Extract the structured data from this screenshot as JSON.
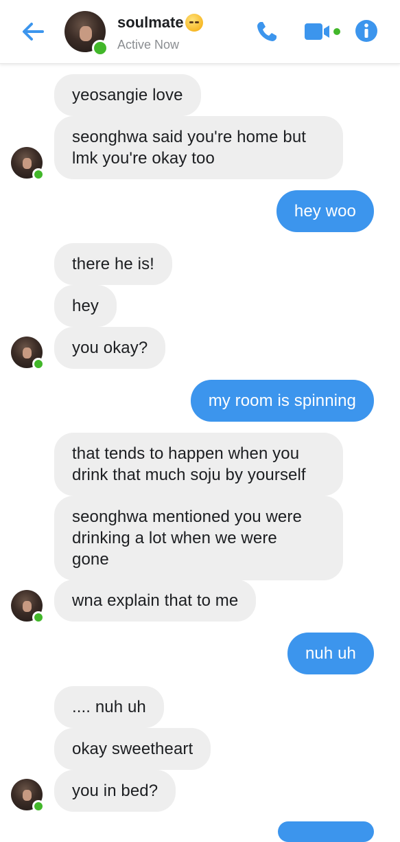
{
  "header": {
    "name": "soulmate",
    "status": "Active Now",
    "emoji_icon": "grimacing-face-icon",
    "back_icon": "back-arrow-icon",
    "call_icon": "phone-icon",
    "video_icon": "video-camera-icon",
    "info_icon": "info-icon",
    "accent_color": "#3c95ed",
    "online_color": "#42b72a"
  },
  "messages": [
    {
      "side": "in",
      "text": "yeosangie love"
    },
    {
      "side": "in",
      "text": "seonghwa said you're home but"
    },
    {
      "side": "in",
      "text": "lmk you're okay too"
    },
    {
      "side": "out",
      "text": "hey woo"
    },
    {
      "side": "in",
      "text": "there he is!"
    },
    {
      "side": "in",
      "text": "hey"
    },
    {
      "side": "in",
      "text": "you okay?"
    },
    {
      "side": "out",
      "text": "my room is spinning"
    },
    {
      "side": "in",
      "text": "that tends to happen when you"
    },
    {
      "side": "in",
      "text": "drink that much soju by yourself"
    },
    {
      "side": "in",
      "text": "seonghwa mentioned you were"
    },
    {
      "side": "in",
      "text": "drinking a lot when we were"
    },
    {
      "side": "in",
      "text": "gone"
    },
    {
      "side": "in",
      "text": "wna explain that to me"
    },
    {
      "side": "out",
      "text": "nuh uh"
    },
    {
      "side": "in",
      "text": ".... nuh uh"
    },
    {
      "side": "in",
      "text": "okay sweetheart"
    },
    {
      "side": "in",
      "text": "you in bed?"
    }
  ]
}
